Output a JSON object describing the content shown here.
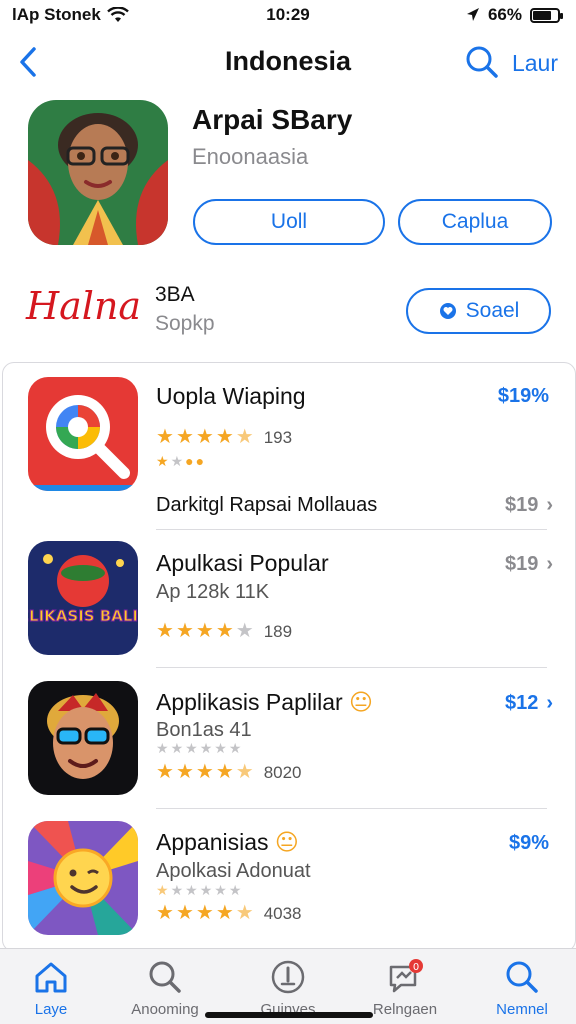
{
  "status": {
    "carrier": "lAp Stonek",
    "time": "10:29",
    "battery": "66%",
    "battery_level": 0.66
  },
  "nav": {
    "title": "Indonesia",
    "right_label": "Laur"
  },
  "hero": {
    "title": "Arpai SBary",
    "subtitle": "Enoonaasia",
    "button_1": "Uoll",
    "button_2": "Caplua"
  },
  "developer": {
    "logo_text": "Halna",
    "name": "3BA",
    "subtitle": "Sopkp",
    "social_button": "Soael"
  },
  "apps": [
    {
      "name": "Uopla Wiaping",
      "price": "$19%",
      "rating": 4.5,
      "rating_count": "193",
      "rating_row2": 2,
      "extra": "Darkitgl Rapsai Mollauas",
      "extra_price": "$19"
    },
    {
      "name": "Apulkasi Popular",
      "sub": "Ap 128k 11K",
      "price": "$19",
      "rating": 4,
      "rating_count": "189",
      "art_text": "MELIKASIS BALIHA"
    },
    {
      "name": "Applikasis Paplilar",
      "emoji": "😐",
      "sub": "Bon1as 41",
      "price": "$12",
      "rating": 4.5,
      "rating_count": "8020",
      "rating_row2": 0
    },
    {
      "name": "Appanisias",
      "emoji": "😐",
      "sub": "Apolkasi Adonuat",
      "price": "$9%",
      "rating": 4.5,
      "rating_count": "4038",
      "rating_row2": 0.5
    }
  ],
  "tabs": [
    {
      "label": "Laye",
      "icon": "home-icon",
      "active": true
    },
    {
      "label": "Anooming",
      "icon": "search-icon",
      "active": false
    },
    {
      "label": "Guinves",
      "icon": "info-icon",
      "active": false
    },
    {
      "label": "Relngaen",
      "icon": "chat-icon",
      "active": false,
      "badge": "0"
    },
    {
      "label": "Nemnel",
      "icon": "search-icon",
      "active": true
    }
  ],
  "colors": {
    "accent": "#1a73e8",
    "star": "#f5a623",
    "dev_logo": "#d5171f"
  }
}
